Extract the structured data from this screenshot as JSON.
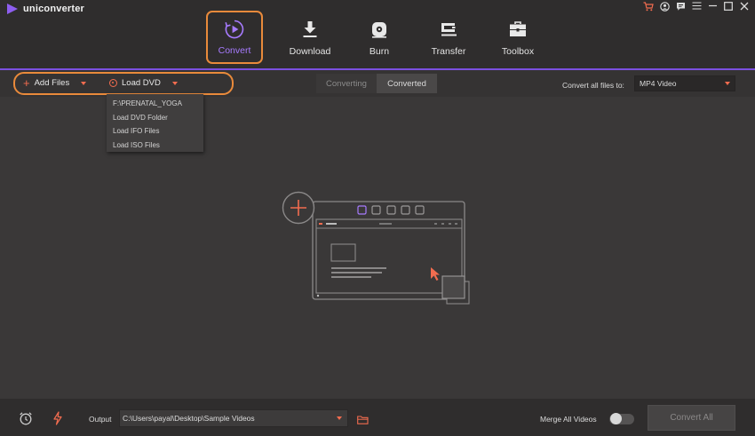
{
  "app": {
    "name": "uniconverter",
    "brand_color": "#7b4fe0",
    "highlight_color": "#e98a3b",
    "accent_color": "#f26c4f"
  },
  "window_controls": [
    "cart-icon",
    "user-icon",
    "feedback-icon",
    "menu-icon",
    "minimize-icon",
    "maximize-icon",
    "close-icon"
  ],
  "nav": {
    "items": [
      {
        "label": "Convert",
        "icon": "convert-icon",
        "active": true
      },
      {
        "label": "Download",
        "icon": "download-icon",
        "active": false
      },
      {
        "label": "Burn",
        "icon": "burn-icon",
        "active": false
      },
      {
        "label": "Transfer",
        "icon": "transfer-icon",
        "active": false
      },
      {
        "label": "Toolbox",
        "icon": "toolbox-icon",
        "active": false
      }
    ]
  },
  "toolbar": {
    "add_files": "Add Files",
    "load_dvd": "Load DVD",
    "tabs": [
      {
        "label": "Converting",
        "selected": false
      },
      {
        "label": "Converted",
        "selected": true
      }
    ],
    "convert_all_to_label": "Convert all files to:",
    "format_value": "MP4 Video"
  },
  "dvd_menu": {
    "items": [
      "F:\\PRENATAL_YOGA",
      "Load DVD Folder",
      "Load IFO Files",
      "Load ISO Files"
    ]
  },
  "bottom": {
    "output_label": "Output",
    "output_path": "C:\\Users\\payal\\Desktop\\Sample Videos",
    "merge_label": "Merge All Videos",
    "merge_enabled": false,
    "convert_all": "Convert All"
  }
}
